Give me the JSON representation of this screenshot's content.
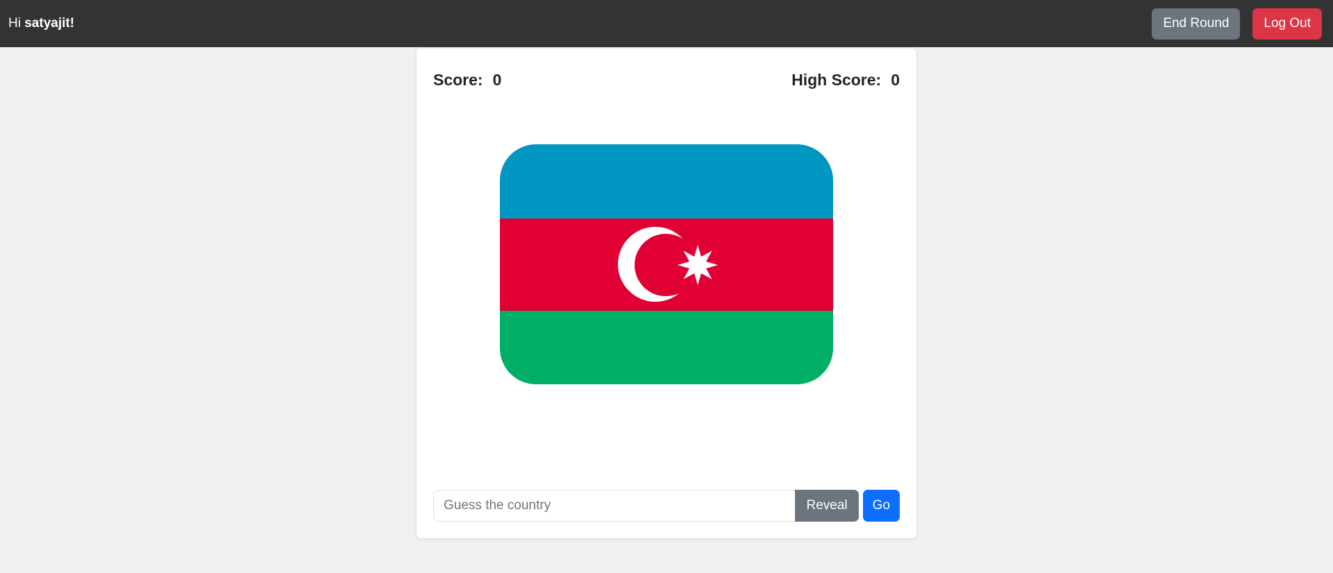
{
  "navbar": {
    "greeting_prefix": "Hi",
    "username": "satyajit!",
    "end_round_label": "End Round",
    "logout_label": "Log Out"
  },
  "score": {
    "score_label": "Score:",
    "score_value": "0",
    "high_score_label": "High Score:",
    "high_score_value": "0"
  },
  "flag": {
    "country_icon": "azerbaijan-flag",
    "colors": {
      "blue": "#0098c3",
      "red": "#e00034",
      "green": "#00ae65",
      "emblem": "#ffffff"
    }
  },
  "guess": {
    "placeholder": "Guess the country",
    "value": "",
    "reveal_label": "Reveal",
    "go_label": "Go"
  },
  "colors": {
    "navbar_bg": "#333333",
    "page_bg": "#f0f0f0",
    "secondary": "#6c757d",
    "danger": "#dc3545",
    "primary": "#0d6efd"
  }
}
